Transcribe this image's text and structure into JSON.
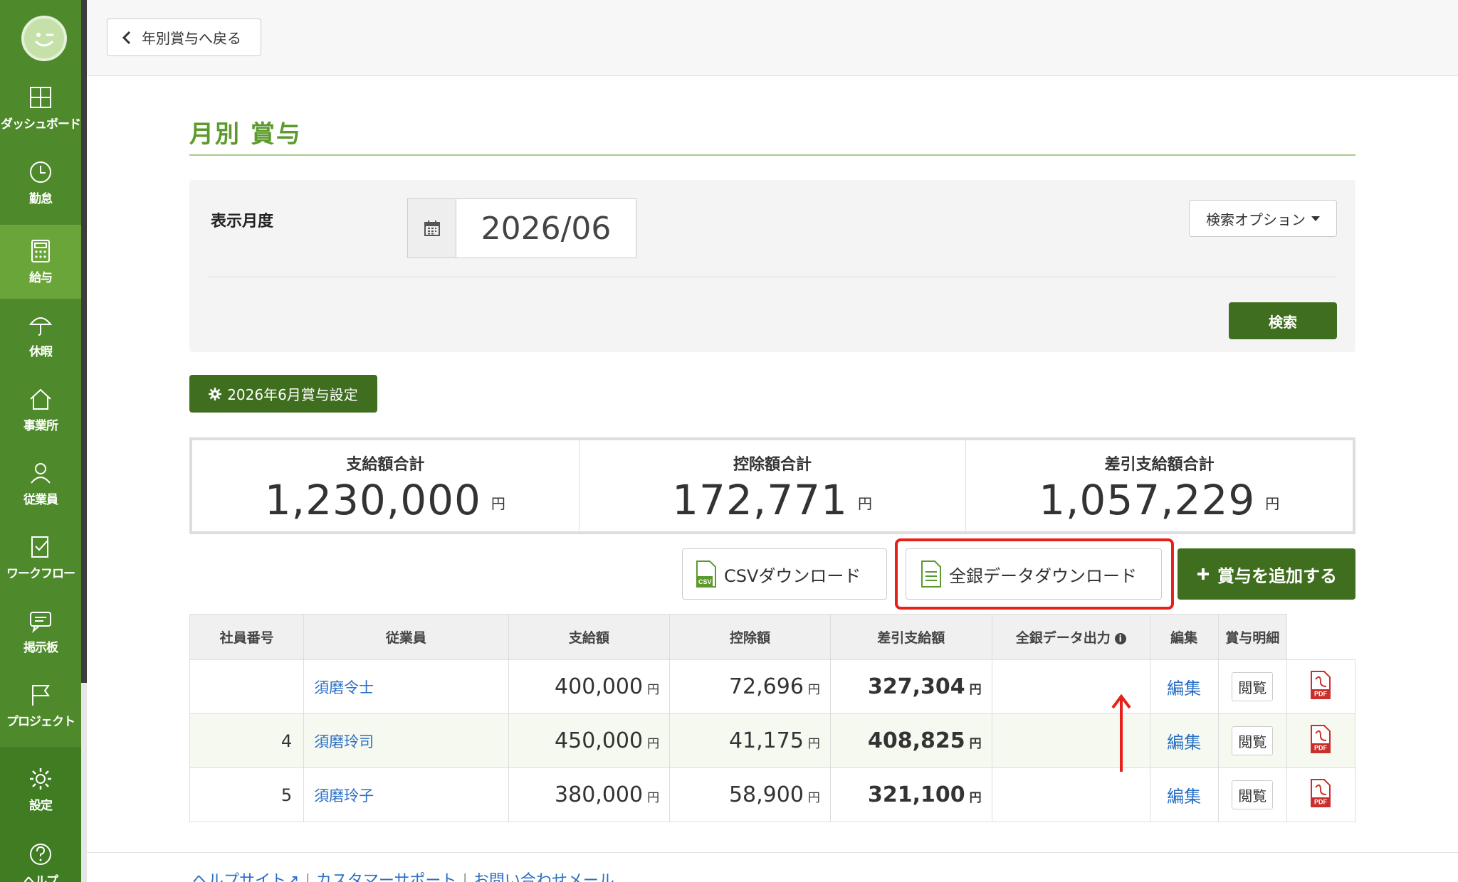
{
  "sidebar": {
    "items": [
      {
        "label": "ダッシュボード",
        "icon": "dashboard-icon"
      },
      {
        "label": "勤怠",
        "icon": "clock-icon"
      },
      {
        "label": "給与",
        "icon": "calculator-icon",
        "active": true
      },
      {
        "label": "休暇",
        "icon": "umbrella-icon"
      },
      {
        "label": "事業所",
        "icon": "home-icon"
      },
      {
        "label": "従業員",
        "icon": "user-icon"
      },
      {
        "label": "ワークフロー",
        "icon": "workflow-icon"
      },
      {
        "label": "掲示板",
        "icon": "chat-icon"
      },
      {
        "label": "プロジェクト",
        "icon": "flag-icon"
      }
    ],
    "settings_label": "設定",
    "help_label": "ヘルプ"
  },
  "topbar": {
    "back_label": "年別賞与へ戻る"
  },
  "page": {
    "title": "月別 賞与"
  },
  "search": {
    "month_label": "表示月度",
    "month_value": "2026/06",
    "options_label": "検索オプション",
    "search_button": "検索"
  },
  "setting_button": "2026年6月賞与設定",
  "summary": {
    "pay_total_label": "支給額合計",
    "pay_total_value": "1,230,000",
    "deduction_total_label": "控除額合計",
    "deduction_total_value": "172,771",
    "net_total_label": "差引支給額合計",
    "net_total_value": "1,057,229",
    "unit": "円"
  },
  "actions": {
    "csv_label": "CSVダウンロード",
    "zengin_label": "全銀データダウンロード",
    "add_label": "賞与を追加する"
  },
  "table": {
    "headers": [
      "社員番号",
      "従業員",
      "支給額",
      "控除額",
      "差引支給額",
      "全銀データ出力",
      "編集",
      "賞与明細"
    ],
    "rows": [
      {
        "number": "",
        "employee": "須磨令士",
        "pay": "400,000",
        "deduction": "72,696",
        "net": "327,304",
        "edit": "編集",
        "view": "閲覧"
      },
      {
        "number": "4",
        "employee": "須磨玲司",
        "pay": "450,000",
        "deduction": "41,175",
        "net": "408,825",
        "edit": "編集",
        "view": "閲覧"
      },
      {
        "number": "5",
        "employee": "須磨玲子",
        "pay": "380,000",
        "deduction": "58,900",
        "net": "321,100",
        "edit": "編集",
        "view": "閲覧"
      }
    ],
    "unit": "円"
  },
  "footer": {
    "help_site": "ヘルプサイト",
    "support": "カスタマーサポート",
    "contact": "お問い合わせメール"
  },
  "colors": {
    "brand_green": "#4e8a2b",
    "dark_green": "#3f6e1e",
    "highlight_red": "#e8201a",
    "link_blue": "#2a6fc4"
  }
}
